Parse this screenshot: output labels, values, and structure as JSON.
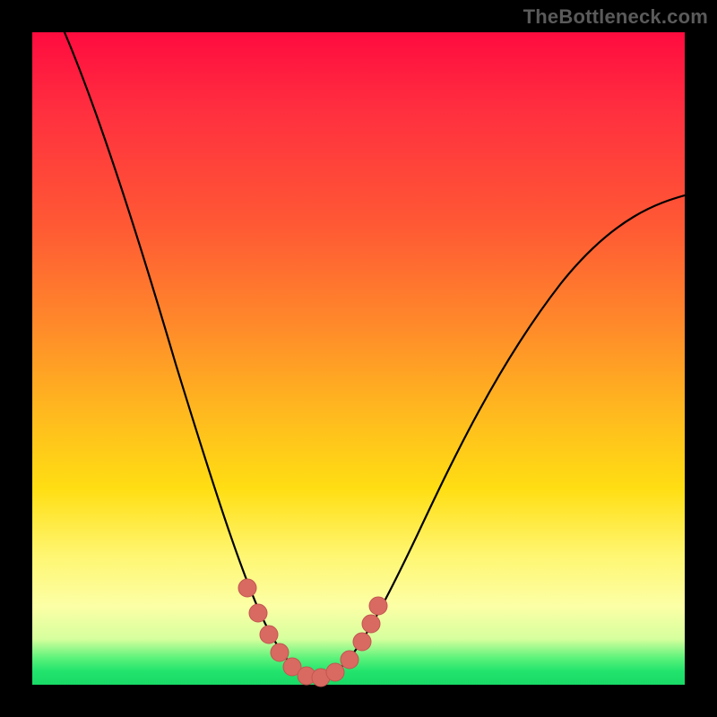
{
  "watermark": {
    "text": "TheBottleneck.com"
  },
  "colors": {
    "gradient_top": "#ff0b3f",
    "gradient_mid1": "#ff8a2a",
    "gradient_mid2": "#ffde13",
    "gradient_low": "#fcffa6",
    "gradient_bottom": "#18da66",
    "curve": "#000000",
    "marker": "#d86a62",
    "frame": "#000000"
  },
  "chart_data": {
    "type": "line",
    "title": "",
    "xlabel": "",
    "ylabel": "",
    "xlim": [
      0,
      100
    ],
    "ylim": [
      0,
      100
    ],
    "note": "Axes are unlabeled in the image; values below are data-space estimates in 0–100 units read from relative pixel positions.",
    "series": [
      {
        "name": "bottleneck-curve",
        "x": [
          5,
          10,
          15,
          20,
          25,
          30,
          33,
          36,
          38,
          40,
          42,
          44,
          46,
          50,
          55,
          60,
          65,
          70,
          75,
          80,
          85,
          90,
          95,
          100
        ],
        "y": [
          100,
          85,
          70,
          56,
          42,
          28,
          18,
          11,
          6,
          3,
          1,
          0.5,
          1,
          4,
          10,
          18,
          27,
          36,
          45,
          53,
          60,
          66,
          71,
          75
        ]
      }
    ],
    "markers": {
      "name": "highlighted-points",
      "x": [
        33,
        35,
        37,
        39,
        41,
        43,
        45,
        47,
        49,
        51,
        53
      ],
      "y": [
        16,
        11,
        7,
        4,
        2,
        1,
        1,
        2,
        4,
        7,
        11
      ]
    }
  }
}
